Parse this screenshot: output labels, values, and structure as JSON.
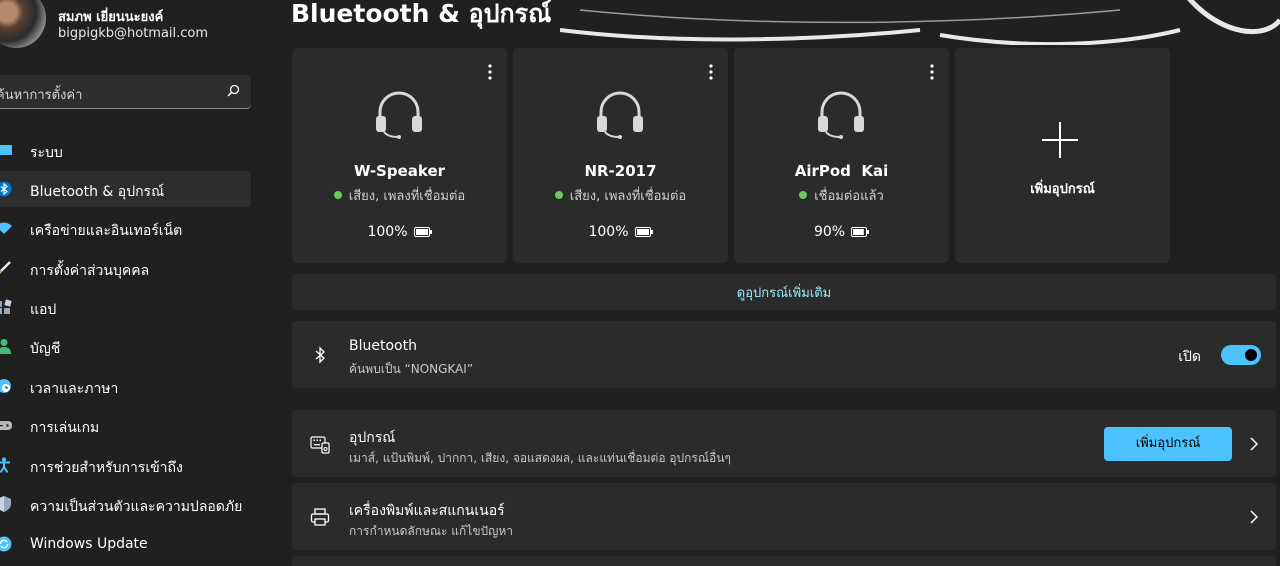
{
  "profile": {
    "name": "สมภพ เยี่ยนนะยงค์",
    "email": "bigpigkb@hotmail.com"
  },
  "search": {
    "placeholder": "ค้นหาการตั้งค่า"
  },
  "sidebar": {
    "items": [
      {
        "label": "ระบบ",
        "icon": "monitor-icon",
        "color": "#4cc2ff"
      },
      {
        "label": "Bluetooth & อุปกรณ์",
        "icon": "bluetooth-icon",
        "color": "#0078d4",
        "active": true
      },
      {
        "label": "เครือข่ายและอินเทอร์เน็ต",
        "icon": "wifi-icon",
        "color": "#4cc2ff"
      },
      {
        "label": "การตั้งค่าส่วนบุคคล",
        "icon": "brush-icon",
        "color": "#e8a060"
      },
      {
        "label": "แอป",
        "icon": "apps-icon",
        "color": "#9aa7b8"
      },
      {
        "label": "บัญชี",
        "icon": "person-icon",
        "color": "#3fc07a"
      },
      {
        "label": "เวลาและภาษา",
        "icon": "globe-clock-icon",
        "color": "#4cc2ff"
      },
      {
        "label": "การเล่นเกม",
        "icon": "gamepad-icon",
        "color": "#b8b8b8"
      },
      {
        "label": "การช่วยสำหรับการเข้าถึง",
        "icon": "accessibility-icon",
        "color": "#4cc2ff"
      },
      {
        "label": "ความเป็นส่วนตัวและความปลอดภัย",
        "icon": "shield-icon",
        "color": "#9aa7b8"
      },
      {
        "label": "Windows Update",
        "icon": "update-icon",
        "color": "#4cc2ff"
      }
    ]
  },
  "main": {
    "title": "Bluetooth & อุปกรณ์",
    "devices": [
      {
        "name": "W-Speaker",
        "status": "เสียง, เพลงที่เชื่อมต่อ",
        "battery": "100%",
        "battery_level": 1.0,
        "icon": "headset-icon"
      },
      {
        "name": "NR-2017",
        "status": "เสียง, เพลงที่เชื่อมต่อ",
        "battery": "100%",
        "battery_level": 1.0,
        "icon": "headset-icon"
      },
      {
        "name": "AirPod  Kai",
        "status": "เชื่อมต่อแล้ว",
        "battery": "90%",
        "battery_level": 0.9,
        "icon": "headset-icon"
      }
    ],
    "add_device_card": {
      "label": "เพิ่มอุปกรณ์",
      "icon": "plus-icon"
    },
    "more_devices_link": "ดูอุปกรณ์เพิ่มเติม",
    "bluetooth_row": {
      "title": "Bluetooth",
      "subtitle": "ค้นพบเป็น “NONGKAI”",
      "toggle_label": "เปิด",
      "toggle_on": true
    },
    "devices_row": {
      "title": "อุปกรณ์",
      "subtitle": "เมาส์, แป้นพิมพ์, ปากกา, เสียง, จอแสดงผล, และแท่นเชื่อมต่อ อุปกรณ์อื่นๆ",
      "button_label": "เพิ่มอุปกรณ์"
    },
    "printers_row": {
      "title": "เครื่องพิมพ์และสแกนเนอร์",
      "subtitle": "การกำหนดลักษณะ แก้ไขปัญหา"
    }
  },
  "colors": {
    "background": "#202020",
    "card": "#2b2b2b",
    "accent": "#4cc2ff",
    "connected_dot": "#6ccb5f",
    "link": "#99ebff"
  }
}
